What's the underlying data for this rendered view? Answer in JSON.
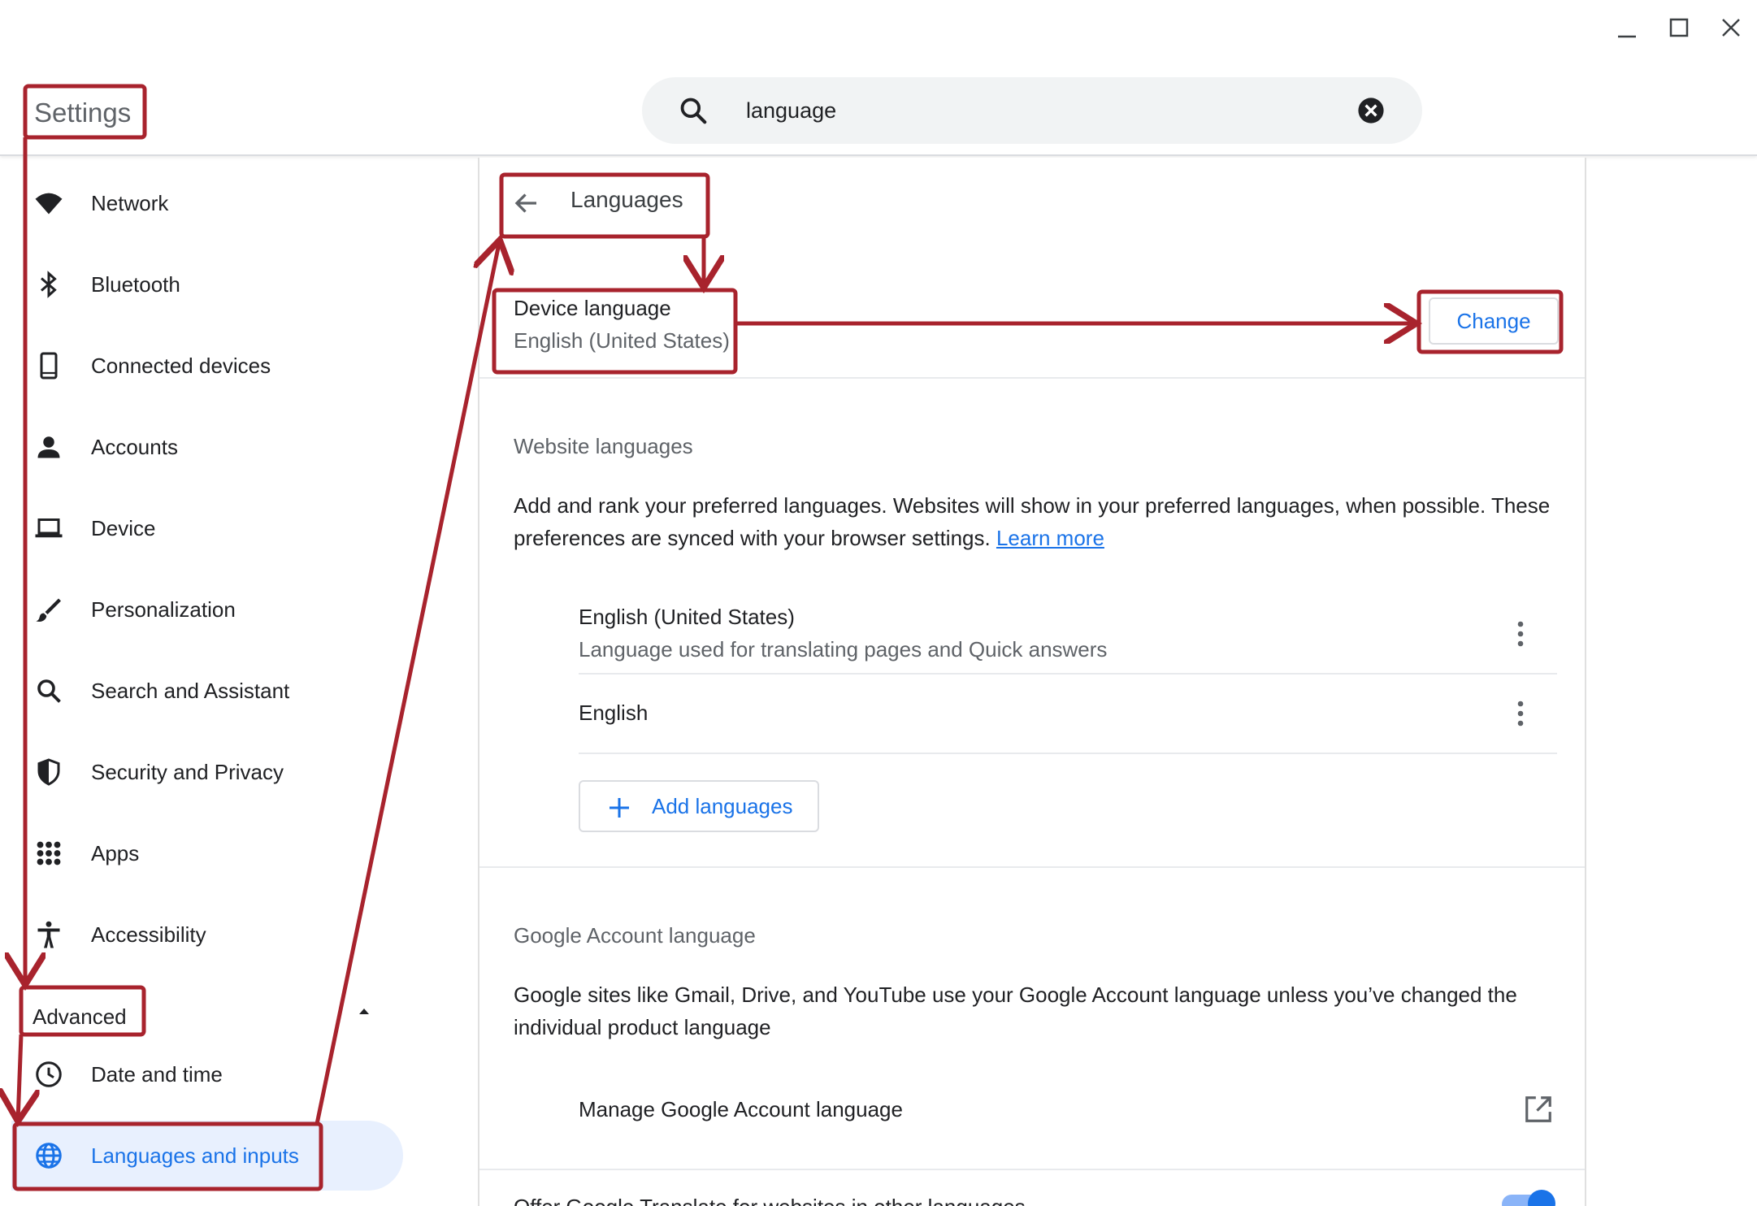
{
  "window": {
    "controls": [
      "minimize-icon",
      "maximize-icon",
      "close-icon"
    ]
  },
  "app": {
    "title": "Settings"
  },
  "search": {
    "value": "language"
  },
  "sidebar": {
    "items": [
      {
        "label": "Network",
        "icon": "wifi-icon"
      },
      {
        "label": "Bluetooth",
        "icon": "bluetooth-icon"
      },
      {
        "label": "Connected devices",
        "icon": "phone-icon"
      },
      {
        "label": "Accounts",
        "icon": "person-icon"
      },
      {
        "label": "Device",
        "icon": "laptop-icon"
      },
      {
        "label": "Personalization",
        "icon": "brush-icon"
      },
      {
        "label": "Search and Assistant",
        "icon": "search-icon"
      },
      {
        "label": "Security and Privacy",
        "icon": "shield-icon"
      },
      {
        "label": "Apps",
        "icon": "apps-grid-icon"
      },
      {
        "label": "Accessibility",
        "icon": "accessibility-icon"
      }
    ],
    "advanced_label": "Advanced",
    "advanced_items": [
      {
        "label": "Date and time",
        "icon": "clock-icon"
      },
      {
        "label": "Languages and inputs",
        "icon": "globe-icon",
        "active": true
      }
    ]
  },
  "main": {
    "page_title": "Languages",
    "device_language": {
      "title": "Device language",
      "value": "English (United States)",
      "change_label": "Change"
    },
    "website_languages": {
      "title": "Website languages",
      "description": "Add and rank your preferred languages. Websites will show in your preferred languages, when possible. These preferences are synced with your browser settings.",
      "learn_more": "Learn more",
      "languages": [
        {
          "name": "English (United States)",
          "note": "Language used for translating pages and Quick answers"
        },
        {
          "name": "English",
          "note": ""
        }
      ],
      "add_label": "Add languages"
    },
    "google_account_language": {
      "title": "Google Account language",
      "description": "Google sites like Gmail, Drive, and YouTube use your Google Account language unless you’ve changed the individual product language",
      "manage_label": "Manage Google Account language"
    },
    "offer_translate": {
      "label": "Offer Google Translate for websites in other languages",
      "enabled": true
    }
  },
  "colors": {
    "accent": "#1a73e8",
    "annotation": "#a8232d",
    "active_bg": "#e8f0fe"
  }
}
